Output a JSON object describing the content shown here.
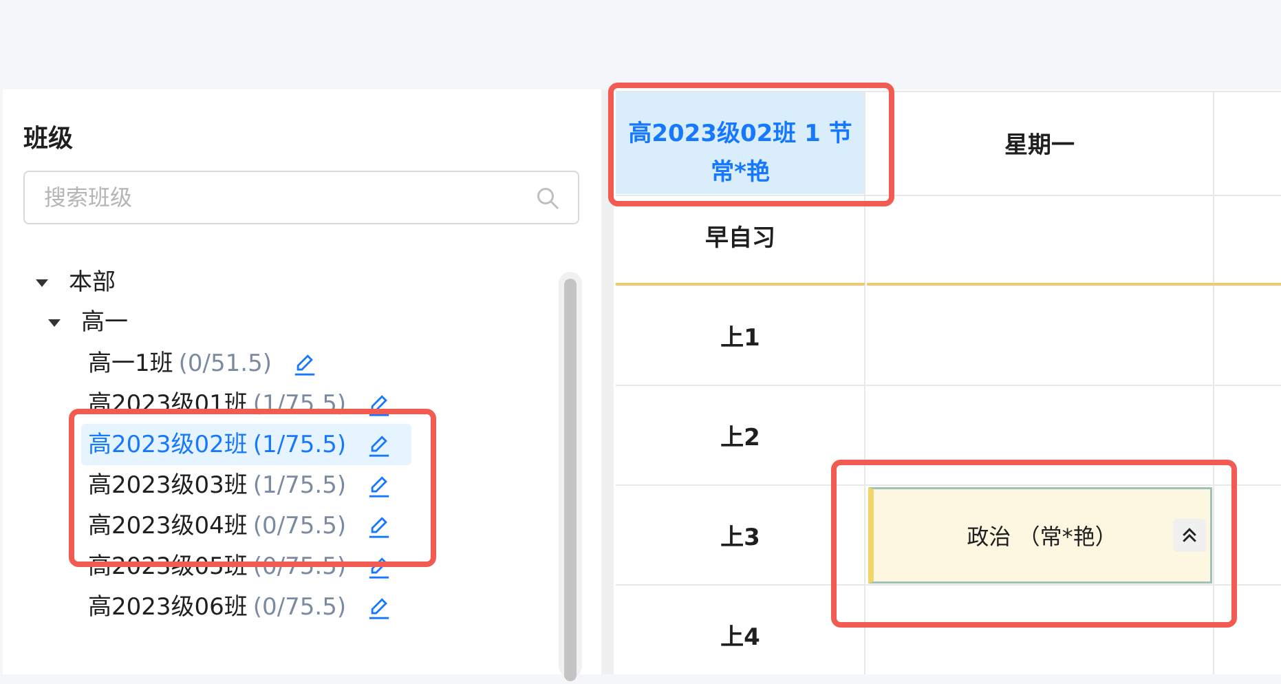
{
  "class_panel": {
    "title": "班级",
    "search_placeholder": "搜索班级"
  },
  "tree": {
    "root": "本部",
    "grade": "高一",
    "classes": [
      {
        "name": "高一1班",
        "count": "(0/51.5)"
      },
      {
        "name": "高2023级01班",
        "count": "(1/75.5)"
      },
      {
        "name": "高2023级02班",
        "count": "(1/75.5)",
        "selected": true
      },
      {
        "name": "高2023级03班",
        "count": "(1/75.5)"
      },
      {
        "name": "高2023级04班",
        "count": "(0/75.5)"
      },
      {
        "name": "高2023级05班",
        "count": "(0/75.5)"
      },
      {
        "name": "高2023级06班",
        "count": "(0/75.5)"
      }
    ]
  },
  "timetable": {
    "corner_line1": "高2023级02班 1 节",
    "corner_line2": "常*艳",
    "day_header": "星期一",
    "rows": [
      "早自习",
      "上1",
      "上2",
      "上3",
      "上4"
    ],
    "lesson": {
      "text": "政治 （常*艳）",
      "icon": "double-chevron-up-icon"
    }
  },
  "colors": {
    "accent": "#1677ff",
    "highlight": "#f25b52",
    "lesson_bg": "#fdf6e1",
    "divider_gold": "#f5c86b"
  }
}
